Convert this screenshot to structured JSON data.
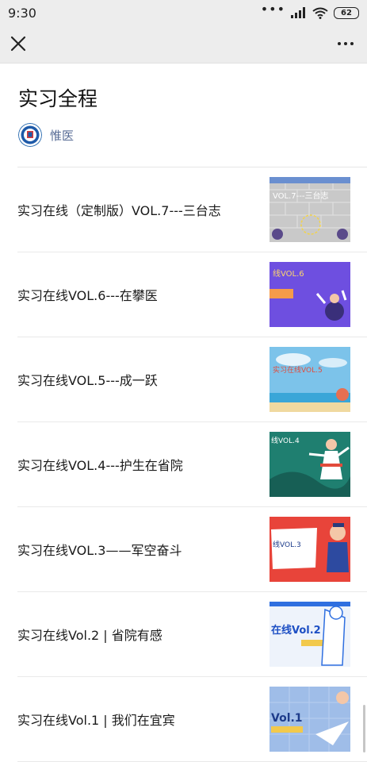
{
  "status": {
    "time": "9:30",
    "battery": "62"
  },
  "article": {
    "title": "实习全程",
    "author": "惟医"
  },
  "items": [
    {
      "label": "实习在线（定制版）VOL.7---三台志",
      "thumb_text": "VOL.7---三台志"
    },
    {
      "label": "实习在线VOL.6---在攀医",
      "thumb_text": "线VOL.6"
    },
    {
      "label": "实习在线VOL.5---成一跃",
      "thumb_text": "实习在线VOL.5"
    },
    {
      "label": "实习在线VOL.4---护生在省院",
      "thumb_text": "线VOL.4"
    },
    {
      "label": "实习在线VOL.3——军空奋斗",
      "thumb_text": "线VOL.3"
    },
    {
      "label": "实习在线Vol.2 | 省院有感",
      "thumb_text": "在线Vol.2"
    },
    {
      "label": "实习在线Vol.1 | 我们在宜宾",
      "thumb_text": "Vol.1"
    }
  ]
}
